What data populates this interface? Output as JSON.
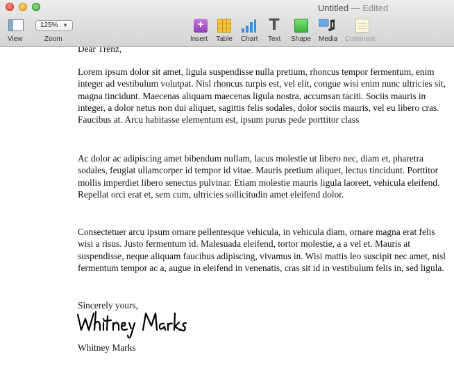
{
  "window": {
    "title": "Untitled",
    "separator": "—",
    "status": "Edited"
  },
  "toolbar": {
    "view_label": "View",
    "zoom_value": "125%",
    "zoom_label": "Zoom",
    "insert_label": "Insert",
    "table_label": "Table",
    "chart_label": "Chart",
    "text_label": "Text",
    "shape_label": "Shape",
    "media_label": "Media",
    "comment_label": "Comment",
    "icons": [
      "view-icon",
      "insert-icon",
      "table-icon",
      "chart-icon",
      "text-icon",
      "shape-icon",
      "media-icon",
      "comment-icon"
    ]
  },
  "document": {
    "greeting": "Dear Trenz,",
    "paragraphs": [
      "Lorem ipsum dolor sit amet, ligula suspendisse nulla pretium, rhoncus tempor fermentum, enim integer ad vestibulum volutpat. Nisl rhoncus turpis est, vel elit, congue wisi enim nunc ultricies sit, magna tincidunt. Maecenas aliquam maecenas ligula nostra, accumsan taciti. Sociis mauris in integer, a dolor netus non dui aliquet, sagittis felis sodales, dolor sociis mauris, vel eu libero cras. Faucibus at. Arcu habitasse elementum est, ipsum purus pede porttitor class",
      "Ac dolor ac adipiscing amet bibendum nullam, lacus molestie ut libero nec, diam et, pharetra sodales, feugiat ullamcorper id tempor id vitae. Mauris pretium aliquet, lectus tincidunt. Porttitor mollis imperdiet libero senectus pulvinar. Etiam molestie mauris ligula laoreet, vehicula eleifend. Repellat orci erat et, sem cum, ultricies sollicitudin amet eleifend dolor.",
      "Consectetuer arcu ipsum ornare pellentesque vehicula, in vehicula diam, ornare magna erat felis wisi a risus. Justo fermentum id. Malesuada eleifend, tortor molestie, a a vel et. Mauris at suspendisse, neque aliquam faucibus adipiscing, vivamus in. Wisi mattis leo suscipit nec amet, nisl fermentum tempor ac a, augue in eleifend in venenatis, cras sit id in vestibulum felis in, sed ligula."
    ],
    "closing": "Sincerely yours,",
    "signature_script": "Whitney Marks",
    "signature_name": "Whitney Marks"
  },
  "colors": {
    "toolbar_top": "#ececec",
    "toolbar_bottom": "#d3d3d3",
    "text": "#111111"
  }
}
